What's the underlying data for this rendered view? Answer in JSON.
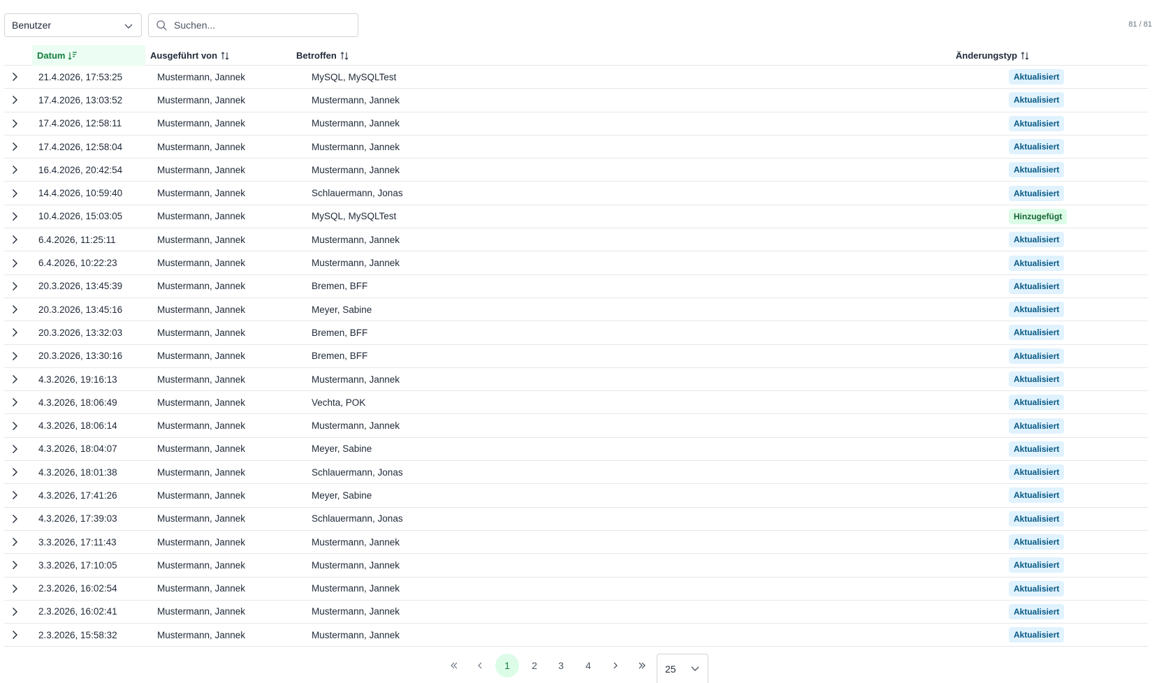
{
  "toolbar": {
    "filter_select_value": "Benutzer",
    "search_placeholder": "Suchen...",
    "record_count": "81 / 81"
  },
  "table": {
    "columns": {
      "date": "Datum",
      "executed_by": "Ausgeführt von",
      "affected": "Betroffen",
      "change_type": "Änderungstyp"
    },
    "sorted_column": "date",
    "rows": [
      {
        "date": "21.4.2026, 17:53:25",
        "executed_by": "Mustermann, Jannek",
        "affected": "MySQL, MySQLTest",
        "type": "Aktualisiert",
        "kind": "upd"
      },
      {
        "date": "17.4.2026, 13:03:52",
        "executed_by": "Mustermann, Jannek",
        "affected": "Mustermann, Jannek",
        "type": "Aktualisiert",
        "kind": "upd"
      },
      {
        "date": "17.4.2026, 12:58:11",
        "executed_by": "Mustermann, Jannek",
        "affected": "Mustermann, Jannek",
        "type": "Aktualisiert",
        "kind": "upd"
      },
      {
        "date": "17.4.2026, 12:58:04",
        "executed_by": "Mustermann, Jannek",
        "affected": "Mustermann, Jannek",
        "type": "Aktualisiert",
        "kind": "upd"
      },
      {
        "date": "16.4.2026, 20:42:54",
        "executed_by": "Mustermann, Jannek",
        "affected": "Mustermann, Jannek",
        "type": "Aktualisiert",
        "kind": "upd"
      },
      {
        "date": "14.4.2026, 10:59:40",
        "executed_by": "Mustermann, Jannek",
        "affected": "Schlauermann, Jonas",
        "type": "Aktualisiert",
        "kind": "upd"
      },
      {
        "date": "10.4.2026, 15:03:05",
        "executed_by": "Mustermann, Jannek",
        "affected": "MySQL, MySQLTest",
        "type": "Hinzugefügt",
        "kind": "add"
      },
      {
        "date": "6.4.2026, 11:25:11",
        "executed_by": "Mustermann, Jannek",
        "affected": "Mustermann, Jannek",
        "type": "Aktualisiert",
        "kind": "upd"
      },
      {
        "date": "6.4.2026, 10:22:23",
        "executed_by": "Mustermann, Jannek",
        "affected": "Mustermann, Jannek",
        "type": "Aktualisiert",
        "kind": "upd"
      },
      {
        "date": "20.3.2026, 13:45:39",
        "executed_by": "Mustermann, Jannek",
        "affected": "Bremen, BFF",
        "type": "Aktualisiert",
        "kind": "upd"
      },
      {
        "date": "20.3.2026, 13:45:16",
        "executed_by": "Mustermann, Jannek",
        "affected": "Meyer, Sabine",
        "type": "Aktualisiert",
        "kind": "upd"
      },
      {
        "date": "20.3.2026, 13:32:03",
        "executed_by": "Mustermann, Jannek",
        "affected": "Bremen, BFF",
        "type": "Aktualisiert",
        "kind": "upd"
      },
      {
        "date": "20.3.2026, 13:30:16",
        "executed_by": "Mustermann, Jannek",
        "affected": "Bremen, BFF",
        "type": "Aktualisiert",
        "kind": "upd"
      },
      {
        "date": "4.3.2026, 19:16:13",
        "executed_by": "Mustermann, Jannek",
        "affected": "Mustermann, Jannek",
        "type": "Aktualisiert",
        "kind": "upd"
      },
      {
        "date": "4.3.2026, 18:06:49",
        "executed_by": "Mustermann, Jannek",
        "affected": "Vechta, POK",
        "type": "Aktualisiert",
        "kind": "upd"
      },
      {
        "date": "4.3.2026, 18:06:14",
        "executed_by": "Mustermann, Jannek",
        "affected": "Mustermann, Jannek",
        "type": "Aktualisiert",
        "kind": "upd"
      },
      {
        "date": "4.3.2026, 18:04:07",
        "executed_by": "Mustermann, Jannek",
        "affected": "Meyer, Sabine",
        "type": "Aktualisiert",
        "kind": "upd"
      },
      {
        "date": "4.3.2026, 18:01:38",
        "executed_by": "Mustermann, Jannek",
        "affected": "Schlauermann, Jonas",
        "type": "Aktualisiert",
        "kind": "upd"
      },
      {
        "date": "4.3.2026, 17:41:26",
        "executed_by": "Mustermann, Jannek",
        "affected": "Meyer, Sabine",
        "type": "Aktualisiert",
        "kind": "upd"
      },
      {
        "date": "4.3.2026, 17:39:03",
        "executed_by": "Mustermann, Jannek",
        "affected": "Schlauermann, Jonas",
        "type": "Aktualisiert",
        "kind": "upd"
      },
      {
        "date": "3.3.2026, 17:11:43",
        "executed_by": "Mustermann, Jannek",
        "affected": "Mustermann, Jannek",
        "type": "Aktualisiert",
        "kind": "upd"
      },
      {
        "date": "3.3.2026, 17:10:05",
        "executed_by": "Mustermann, Jannek",
        "affected": "Mustermann, Jannek",
        "type": "Aktualisiert",
        "kind": "upd"
      },
      {
        "date": "2.3.2026, 16:02:54",
        "executed_by": "Mustermann, Jannek",
        "affected": "Mustermann, Jannek",
        "type": "Aktualisiert",
        "kind": "upd"
      },
      {
        "date": "2.3.2026, 16:02:41",
        "executed_by": "Mustermann, Jannek",
        "affected": "Mustermann, Jannek",
        "type": "Aktualisiert",
        "kind": "upd"
      },
      {
        "date": "2.3.2026, 15:58:32",
        "executed_by": "Mustermann, Jannek",
        "affected": "Mustermann, Jannek",
        "type": "Aktualisiert",
        "kind": "upd"
      }
    ]
  },
  "pagination": {
    "pages": [
      "1",
      "2",
      "3",
      "4"
    ],
    "current_page": "1",
    "page_size": "25"
  },
  "colors": {
    "accent_green": "#15803d",
    "updated_badge_bg": "#e0f2fe",
    "updated_badge_text": "#075985",
    "added_badge_bg": "#dcfce7",
    "added_badge_text": "#166534"
  }
}
